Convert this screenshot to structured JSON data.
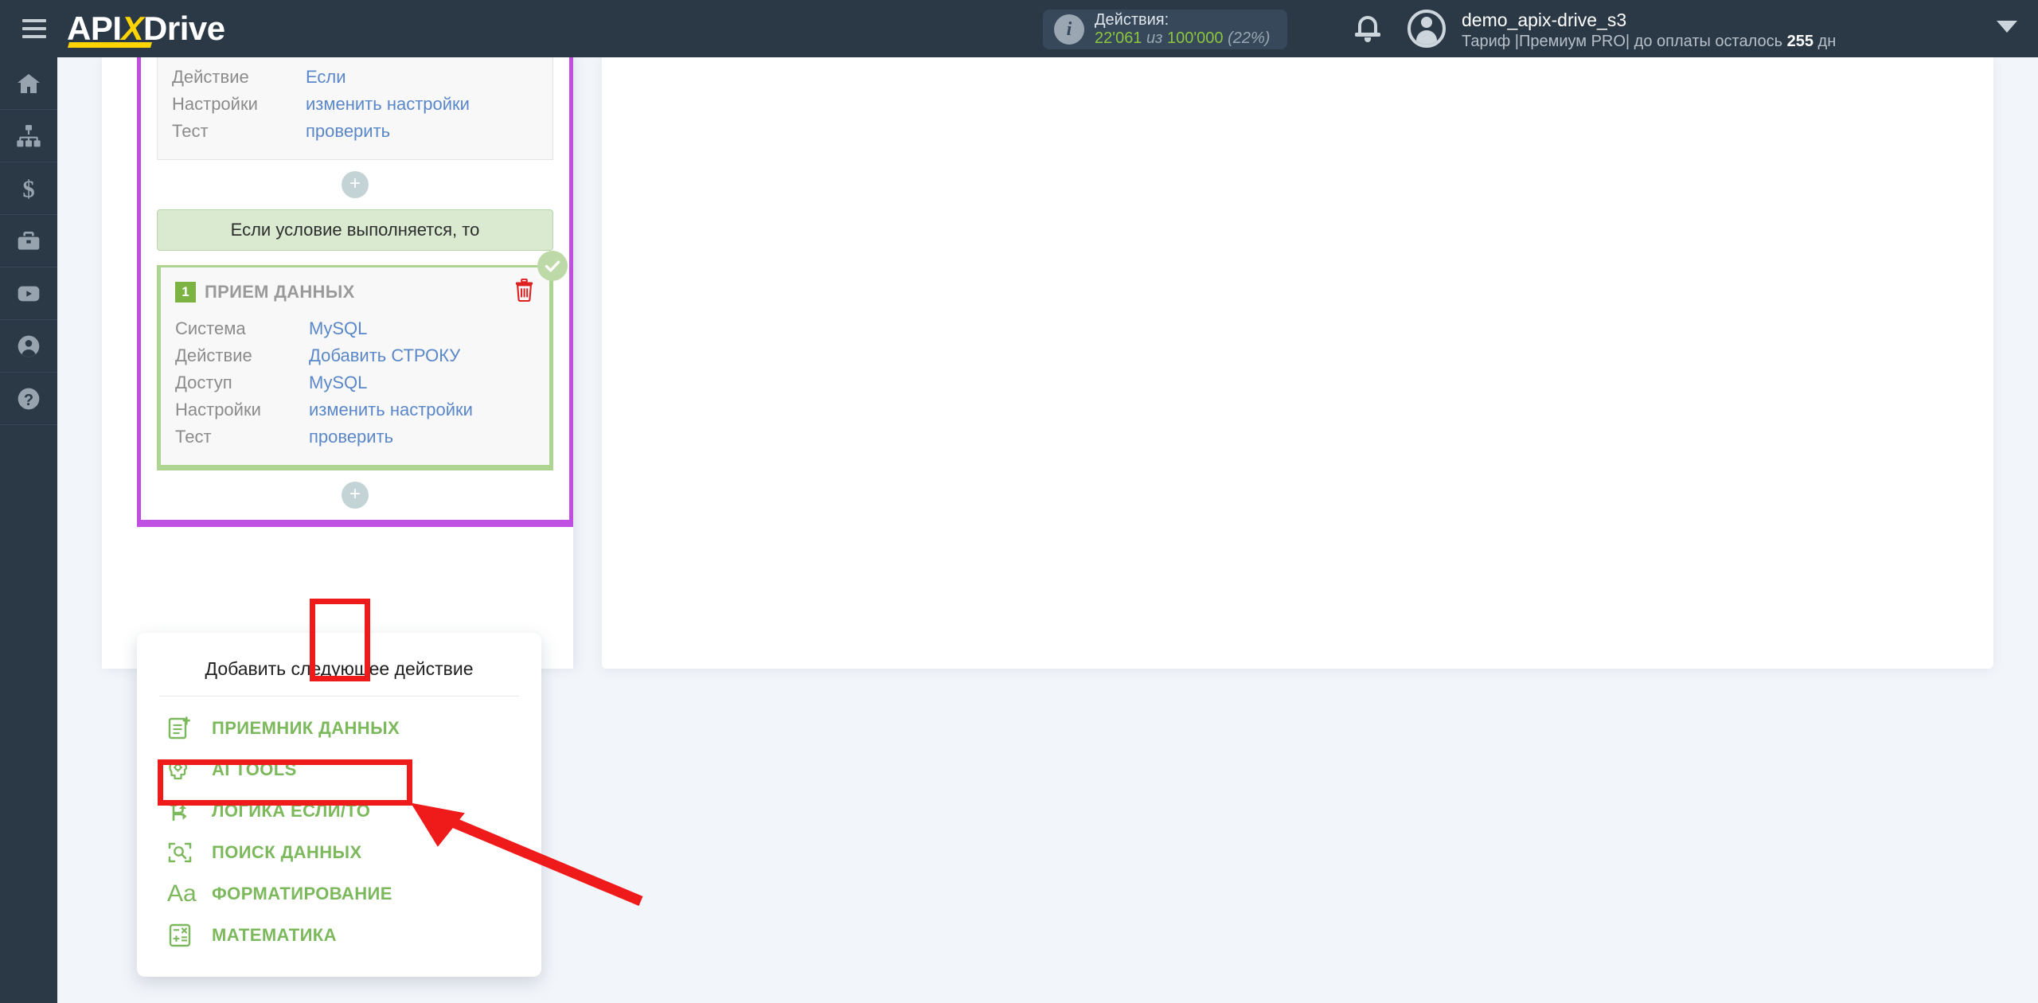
{
  "header": {
    "logo": {
      "part1": "API",
      "x": "X",
      "part2": "Drive"
    },
    "menu_icon": "hamburger-icon",
    "actions": {
      "title": "Действия:",
      "used": "22'061",
      "of": "из",
      "total": "100'000",
      "percent": "(22%)"
    },
    "user": {
      "name": "demo_apix-drive_s3",
      "plan_prefix": "Тариф |Премиум PRO| до оплаты осталось ",
      "plan_days": "255",
      "plan_suffix": " дн"
    }
  },
  "sidebar": {
    "items": [
      {
        "name": "home",
        "label": "Главная"
      },
      {
        "name": "connections",
        "label": "Связи"
      },
      {
        "name": "billing",
        "label": "Оплата"
      },
      {
        "name": "briefcase",
        "label": "Кейсы"
      },
      {
        "name": "youtube",
        "label": "Видео"
      },
      {
        "name": "profile",
        "label": "Профиль"
      },
      {
        "name": "help",
        "label": "Помощь"
      }
    ]
  },
  "flow": {
    "if_card": {
      "rows": [
        {
          "label": "Действие",
          "value": "Если"
        },
        {
          "label": "Настройки",
          "value": "изменить настройки"
        },
        {
          "label": "Тест",
          "value": "проверить"
        }
      ]
    },
    "plus_label": "+",
    "condition_banner": "Если условие выполняется, то",
    "receiver_card": {
      "badge": "1",
      "title": "ПРИЕМ ДАННЫХ",
      "delete_icon": "trash-icon",
      "status_icon": "check-icon",
      "rows": [
        {
          "label": "Система",
          "value": "MySQL"
        },
        {
          "label": "Действие",
          "value": "Добавить СТРОКУ"
        },
        {
          "label": "Доступ",
          "value": "MySQL"
        },
        {
          "label": "Настройки",
          "value": "изменить настройки"
        },
        {
          "label": "Тест",
          "value": "проверить"
        }
      ]
    }
  },
  "menu": {
    "title": "Добавить следующее действие",
    "items": [
      {
        "icon": "document-add-icon",
        "label": "ПРИЕМНИК ДАННЫХ"
      },
      {
        "icon": "ai-head-icon",
        "label": "AI TOOLS"
      },
      {
        "icon": "branch-icon",
        "label": "ЛОГИКА ЕСЛИ/ТО"
      },
      {
        "icon": "search-scan-icon",
        "label": "ПОИСК ДАННЫХ"
      },
      {
        "icon": "text-format-icon",
        "label": "ФОРМАТИРОВАНИЕ"
      },
      {
        "icon": "calculator-icon",
        "label": "МАТЕМАТИКА"
      }
    ]
  },
  "annotations": {
    "highlight_plus": "add-next-action-plus-button",
    "highlight_logic": "ЛОГИКА ЕСЛИ/ТО",
    "arrow": "red-arrow-pointing-to-logic-item",
    "color": "#ef1a1a"
  },
  "colors": {
    "topbar": "#2b3947",
    "accent_yellow": "#ffd400",
    "green": "#7cb85c",
    "purple": "#c04fe0",
    "link_blue": "#5a87c9",
    "annotation_red": "#ef1a1a"
  }
}
